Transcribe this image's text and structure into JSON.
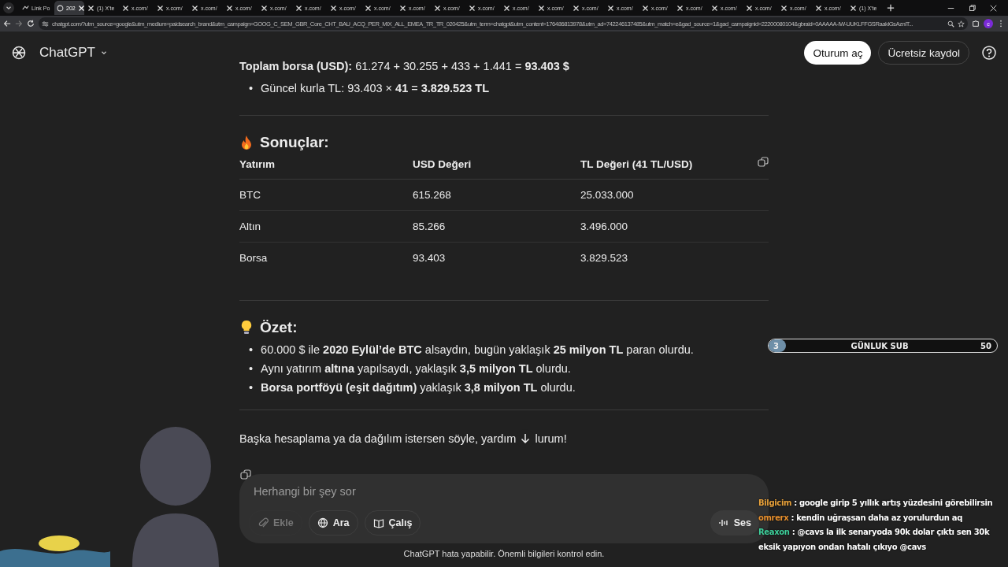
{
  "browser": {
    "tabs": [
      {
        "label": "Link Po",
        "kind": "link",
        "selected": false
      },
      {
        "label": "202",
        "kind": "chat",
        "selected": true
      },
      {
        "label": "(1) X'te",
        "kind": "x",
        "selected": false
      },
      {
        "label": "x.com/",
        "kind": "x",
        "selected": false
      },
      {
        "label": "x.com/",
        "kind": "x",
        "selected": false
      },
      {
        "label": "x.com/",
        "kind": "x",
        "selected": false
      },
      {
        "label": "x.com/",
        "kind": "x",
        "selected": false
      },
      {
        "label": "x.com/",
        "kind": "x",
        "selected": false
      },
      {
        "label": "x.com/",
        "kind": "x",
        "selected": false
      },
      {
        "label": "x.com/",
        "kind": "x",
        "selected": false
      },
      {
        "label": "x.com/",
        "kind": "x",
        "selected": false
      },
      {
        "label": "x.com/",
        "kind": "x",
        "selected": false
      },
      {
        "label": "x.com/",
        "kind": "x",
        "selected": false
      },
      {
        "label": "x.com/",
        "kind": "x",
        "selected": false
      },
      {
        "label": "x.com/",
        "kind": "x",
        "selected": false
      },
      {
        "label": "x.com/",
        "kind": "x",
        "selected": false
      },
      {
        "label": "x.com/",
        "kind": "x",
        "selected": false
      },
      {
        "label": "x.com/",
        "kind": "x",
        "selected": false
      },
      {
        "label": "x.com/",
        "kind": "x",
        "selected": false
      },
      {
        "label": "x.com/",
        "kind": "x",
        "selected": false
      },
      {
        "label": "x.com/",
        "kind": "x",
        "selected": false
      },
      {
        "label": "x.com/",
        "kind": "x",
        "selected": false
      },
      {
        "label": "x.com/",
        "kind": "x",
        "selected": false
      },
      {
        "label": "x.com/",
        "kind": "x",
        "selected": false
      },
      {
        "label": "(1) X'te",
        "kind": "x",
        "selected": false
      }
    ],
    "url": "chatgpt.com/?utm_source=google&utm_medium=paidsearch_brand&utm_campaign=GOOG_C_SEM_GBR_Core_CHT_BAU_ACQ_PER_MIX_ALL_EMEA_TR_TR_020425&utm_term=chatgpt&utm_content=176486813978&utm_ad=742246137485&utm_match=e&gad_source=1&gad_campaignid=22200080104&gbraid=0AAAAA-IW-UUKLFFGSRaaklGsAznIT...",
    "profile": "c"
  },
  "header": {
    "brand": "ChatGPT",
    "buttons": [
      {
        "label": "Oturum aç",
        "kind": "primary"
      },
      {
        "label": "Ücretsiz kaydol",
        "kind": "outline"
      }
    ]
  },
  "answer": {
    "total_line": "**Toplam borsa (USD):** 61.274 + 30.255 + 433 + 1.441 = **93.403 $**",
    "bullet_marker": "•",
    "total_bullets": [
      "Güncel kurla TL: 93.403 × **41** = **3.829.523 TL**"
    ],
    "results": {
      "heading": "Sonuçlar:",
      "columns": [
        "Yatırım",
        "USD Değeri",
        "TL Değeri (41 TL/USD)"
      ],
      "rows": [
        [
          "BTC",
          "615.268",
          "25.033.000"
        ],
        [
          "Altın",
          "85.266",
          "3.496.000"
        ],
        [
          "Borsa",
          "93.403",
          "3.829.523"
        ]
      ]
    },
    "summary": {
      "heading": "Özet:",
      "bullets": [
        "60.000 $ ile **2020 Eylül’de BTC** alsaydın, bugün yaklaşık **25 milyon TL** paran olurdu.",
        "Aynı yatırım **altına** yapılsaydı, yaklaşık **3,5 milyon TL** olurdu.",
        "**Borsa portföyü (eşit dağıtım)** yaklaşık **3,8 milyon TL** olurdu."
      ]
    },
    "closing_before": "Başka hesaplama ya da dağılım istersen söyle, yardım",
    "closing_after": "lurum!"
  },
  "composer": {
    "placeholder": "Herhangi bir şey sor",
    "tools": [
      {
        "label": "Ekle",
        "kind": "attach",
        "disabled": true
      },
      {
        "label": "Ara",
        "kind": "search",
        "disabled": false
      },
      {
        "label": "Çalış",
        "kind": "study",
        "disabled": false
      }
    ],
    "voice": "Ses"
  },
  "footer": "ChatGPT hata yapabilir. Önemli bilgileri kontrol edin.",
  "overlay": {
    "sub_goal": {
      "current": "3",
      "label": "GÜNLUK SUB",
      "target": "50",
      "level": 0.06
    },
    "chat": [
      {
        "user": "Bilgicim",
        "color": "#e9a23b",
        "text": ": google girip 5 yıllık artış yüzdesini görebilirsin"
      },
      {
        "user": "omrerx",
        "color": "#e8902e",
        "text": ": kendin uğraşsan daha az yorulurdun aq"
      },
      {
        "user": "Reaxon",
        "color": "#3fcf9b",
        "text": ": @cavs la ilk senaryoda 90k dolar çıktı sen 30k eksik yapıyon ondan hatalı çıkıyo @cavs"
      }
    ]
  }
}
